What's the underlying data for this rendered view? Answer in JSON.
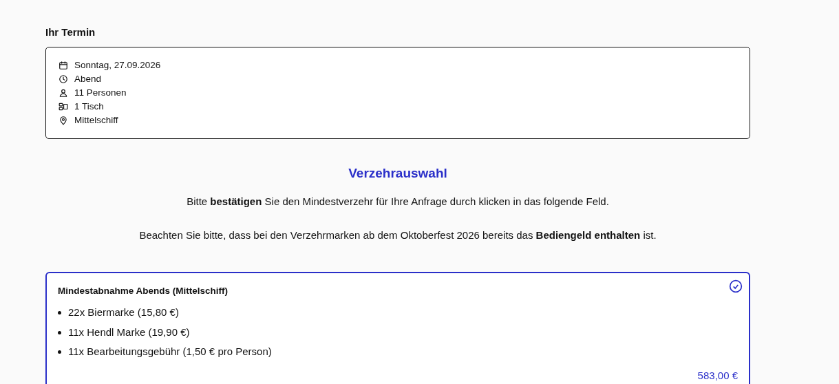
{
  "appointment": {
    "heading": "Ihr Termin",
    "details": [
      {
        "kind": "date",
        "text": "Sonntag, 27.09.2026"
      },
      {
        "kind": "time",
        "text": "Abend"
      },
      {
        "kind": "persons",
        "text": "11 Personen"
      },
      {
        "kind": "table",
        "text": "1 Tisch"
      },
      {
        "kind": "location",
        "text": "Mittelschiff"
      }
    ]
  },
  "selection": {
    "title": "Verzehrauswahl",
    "paragraphs": [
      "Bitte **bestätigen** Sie den Mindestverzehr für Ihre Anfrage durch klicken in das folgende Feld.",
      "Beachten Sie bitte, dass bei den Verzehrmarken ab dem Oktoberfest 2026 bereits das **Bediengeld enthalten** ist."
    ],
    "options": [
      {
        "title": "Mindestabnahme Abends (Mittelschiff)",
        "selected": true,
        "items": [
          "22x Biermarke (15,80 €)",
          "11x Hendl Marke (19,90 €)",
          "11x Bearbeitungsgebühr (1,50 € pro Person)"
        ],
        "price": "583,00 €"
      }
    ]
  }
}
